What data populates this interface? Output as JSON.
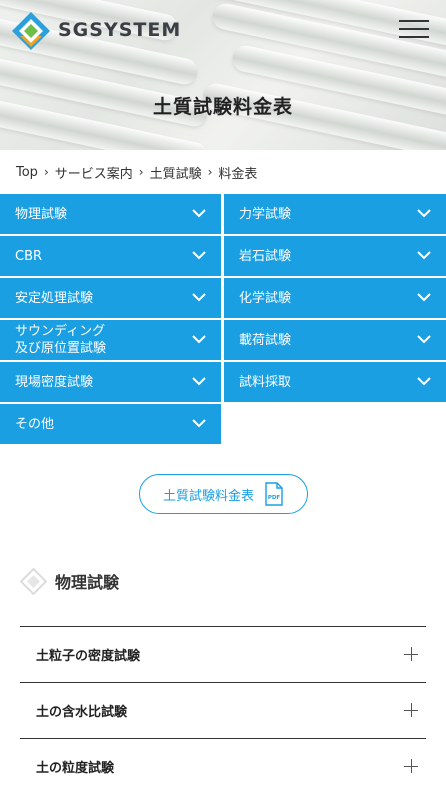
{
  "header": {
    "logo_text": "SGSYSTEM",
    "menu_icon": "hamburger-icon"
  },
  "hero": {
    "title": "土質試験料金表"
  },
  "breadcrumb": {
    "items": [
      "Top",
      "サービス案内",
      "土質試験",
      "料金表"
    ],
    "separator_icon": "chevron-right-icon"
  },
  "categories": {
    "items": [
      {
        "label": "物理試験"
      },
      {
        "label": "力学試験"
      },
      {
        "label": "CBR"
      },
      {
        "label": "岩石試験"
      },
      {
        "label": "安定処理試験"
      },
      {
        "label": "化学試験"
      },
      {
        "label": "サウンディング\n及び原位置試験"
      },
      {
        "label": "載荷試験"
      },
      {
        "label": "現場密度試験"
      },
      {
        "label": "試料採取"
      },
      {
        "label": "その他"
      }
    ],
    "chevron_icon": "chevron-down-icon",
    "color": "#1a9fe3"
  },
  "pdf_button": {
    "label": "土質試験料金表",
    "icon": "pdf-file-icon",
    "icon_text": "PDF"
  },
  "section": {
    "title": "物理試験",
    "icon": "diamond-logo-icon",
    "items": [
      {
        "label": "土粒子の密度試験"
      },
      {
        "label": "土の含水比試験"
      },
      {
        "label": "土の粒度試験"
      }
    ],
    "expand_icon": "plus-icon"
  }
}
